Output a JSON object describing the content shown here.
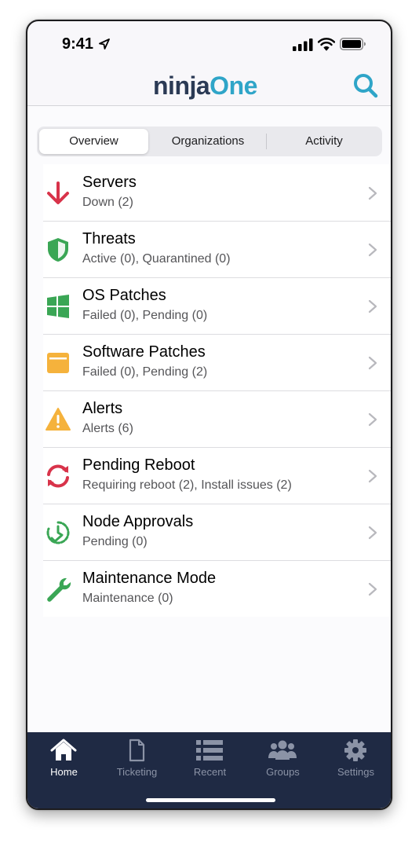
{
  "status_bar": {
    "time": "9:41"
  },
  "header": {
    "logo_part1": "ninja",
    "logo_part2": "One"
  },
  "segments": [
    {
      "label": "Overview",
      "active": true
    },
    {
      "label": "Organizations",
      "active": false
    },
    {
      "label": "Activity",
      "active": false
    }
  ],
  "items": [
    {
      "title": "Servers",
      "subtitle": "Down (2)",
      "icon": "down-arrow-icon",
      "color": "#d8334a"
    },
    {
      "title": "Threats",
      "subtitle": "Active (0), Quarantined (0)",
      "icon": "shield-icon",
      "color": "#3aa655"
    },
    {
      "title": "OS Patches",
      "subtitle": "Failed (0), Pending (0)",
      "icon": "windows-icon",
      "color": "#3aa655"
    },
    {
      "title": "Software Patches",
      "subtitle": "Failed (0), Pending (2)",
      "icon": "window-icon",
      "color": "#f5b23c"
    },
    {
      "title": "Alerts",
      "subtitle": "Alerts (6)",
      "icon": "warning-icon",
      "color": "#f5b23c"
    },
    {
      "title": "Pending Reboot",
      "subtitle": "Requiring reboot (2), Install issues (2)",
      "icon": "refresh-icon",
      "color": "#d8334a"
    },
    {
      "title": "Node Approvals",
      "subtitle": "Pending (0)",
      "icon": "clock-check-icon",
      "color": "#3aa655"
    },
    {
      "title": "Maintenance Mode",
      "subtitle": "Maintenance (0)",
      "icon": "wrench-icon",
      "color": "#3aa655"
    }
  ],
  "tabs": [
    {
      "label": "Home",
      "icon": "home-icon",
      "active": true
    },
    {
      "label": "Ticketing",
      "icon": "document-icon",
      "active": false
    },
    {
      "label": "Recent",
      "icon": "list-icon",
      "active": false
    },
    {
      "label": "Groups",
      "icon": "groups-icon",
      "active": false
    },
    {
      "label": "Settings",
      "icon": "gear-icon",
      "active": false
    }
  ],
  "colors": {
    "accent": "#2fa5c8",
    "tab_bar": "#1f2a44",
    "danger": "#d8334a",
    "success": "#3aa655",
    "warning": "#f5b23c"
  }
}
